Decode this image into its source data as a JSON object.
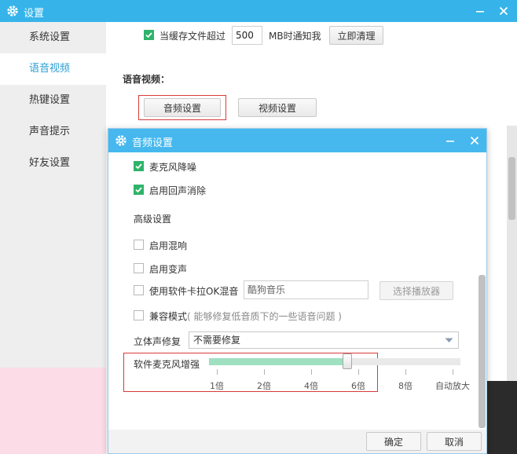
{
  "window": {
    "title": "设置"
  },
  "sidebar": {
    "items": [
      {
        "label": "系统设置",
        "active": false
      },
      {
        "label": "语音视频",
        "active": true
      },
      {
        "label": "热键设置",
        "active": false
      },
      {
        "label": "声音提示",
        "active": false
      },
      {
        "label": "好友设置",
        "active": false
      }
    ]
  },
  "main": {
    "cache": {
      "checked": true,
      "label_before": "当缓存文件超过",
      "value": "500",
      "label_after": "MB时通知我",
      "clear_button": "立即清理"
    },
    "section_title": "语音视频：",
    "audio_button": "音频设置",
    "video_button": "视频设置"
  },
  "dialog": {
    "title": "音频设置",
    "noise_reduction": {
      "label": "麦克风降噪",
      "checked": true
    },
    "echo_cancel": {
      "label": "启用回声消除",
      "checked": true
    },
    "advanced_title": "高级设置",
    "reverb": {
      "label": "启用混响",
      "checked": false
    },
    "voice_change": {
      "label": "启用变声",
      "checked": false
    },
    "karaoke": {
      "label": "使用软件卡拉OK混音",
      "checked": false,
      "player_value": "酷狗音乐",
      "choose_button": "选择播放器"
    },
    "compat": {
      "label": "兼容模式",
      "hint": "( 能够修复低音质下的一些语音问题 )",
      "checked": false
    },
    "stereo": {
      "label": "立体声修复",
      "selected": "不需要修复"
    },
    "mic_boost": {
      "label": "软件麦克风增强",
      "level_fraction": 0.55,
      "ticks": [
        "1倍",
        "2倍",
        "4倍",
        "6倍",
        "8倍",
        "自动放大"
      ]
    },
    "ok_button": "确定",
    "cancel_button": "取消"
  },
  "colors": {
    "titlebar": "#36b4ea",
    "accent_text": "#2a9fd6",
    "checkbox": "#2fb36a",
    "highlight_border": "#d93a3a",
    "slider_fill": "#9fe0c1"
  },
  "icons": {
    "title": "gear-icon",
    "minimize": "minimize-icon",
    "close": "close-icon",
    "check": "checkmark-icon",
    "dropdown": "chevron-down-icon"
  }
}
